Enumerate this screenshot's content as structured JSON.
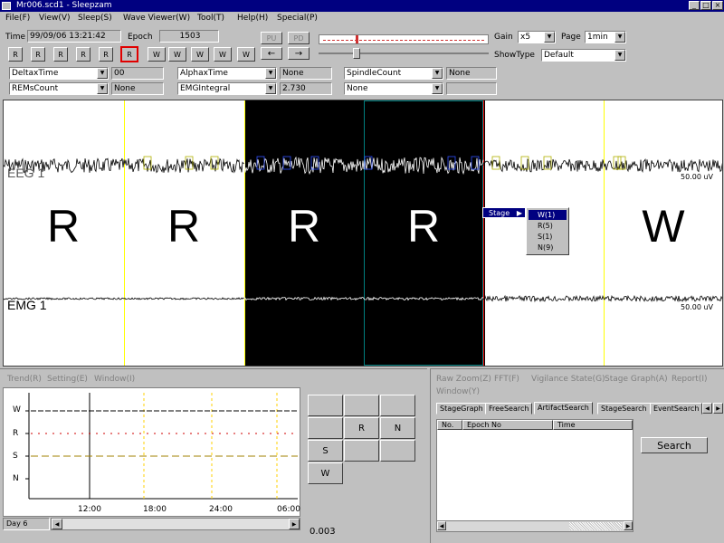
{
  "window": {
    "title": "Mr006.scd1 - Sleepzam"
  },
  "menu": [
    "File(F)",
    "View(V)",
    "Sleep(S)",
    "Wave Viewer(W)",
    "Tool(T)",
    "Help(H)",
    "Special(P)"
  ],
  "toolbar": {
    "time_label": "Time",
    "time_value": "99/09/06 13:21:42",
    "epoch_label": "Epoch",
    "epoch_value": "1503",
    "stage_buttons": [
      "R",
      "R",
      "R",
      "R",
      "R",
      "R",
      "W",
      "W",
      "W",
      "W",
      "W"
    ],
    "nav_buttons": [
      "PU",
      "PD",
      "←",
      "→"
    ],
    "gain_label": "Gain",
    "gain_value": "x5",
    "page_label": "Page",
    "page_value": "1min",
    "showtype_label": "ShowType",
    "showtype_value": "Default"
  },
  "measures": {
    "row1": [
      {
        "select": "DeltaxTime",
        "value": "00"
      },
      {
        "select": "AlphaxTime",
        "value": "None"
      },
      {
        "select": "SpindleCount",
        "value": "None"
      }
    ],
    "row2": [
      {
        "select": "REMsCount",
        "value": "None"
      },
      {
        "select": "EMGIntegral",
        "value": "2.730"
      },
      {
        "select": "None",
        "value": ""
      }
    ]
  },
  "signal": {
    "stages": [
      "R",
      "R",
      "R",
      "R",
      "",
      "W"
    ],
    "channels": [
      {
        "name": "EEG 1",
        "scale": "50.00 uV"
      },
      {
        "name": "EMG 1",
        "scale": "50.00 uV"
      }
    ]
  },
  "context_menu": {
    "label": "Stage",
    "items": [
      "W(1)",
      "R(5)",
      "S(1)",
      "N(9)"
    ]
  },
  "trend": {
    "menu": [
      "Trend(R)",
      "Setting(E)",
      "Window(I)"
    ],
    "y_labels": [
      "W",
      "R",
      "S",
      "N"
    ],
    "x_labels": [
      "12:00",
      "18:00",
      "24:00",
      "06:00"
    ],
    "day": "Day 6"
  },
  "stage_grid": {
    "buttons": [
      "R",
      "N",
      "S",
      "W"
    ],
    "value": "0.003"
  },
  "right_panel": {
    "menu": [
      "Raw Zoom(Z)",
      "FFT(F)",
      "Vigilance State(G)",
      "Stage Graph(A)",
      "Report(I)",
      "Window(Y)"
    ],
    "tabs": [
      "StageGraph",
      "FreeSearch",
      "ArtifactSearch",
      "StageSearch",
      "EventSearch"
    ],
    "columns": [
      "No.",
      "Epoch No",
      "Time"
    ],
    "search_button": "Search"
  },
  "colors": {
    "titlebar": "#000080",
    "epoch_line": "#ffff00",
    "selection_border": "#008080",
    "end_line": "#ff0000"
  }
}
